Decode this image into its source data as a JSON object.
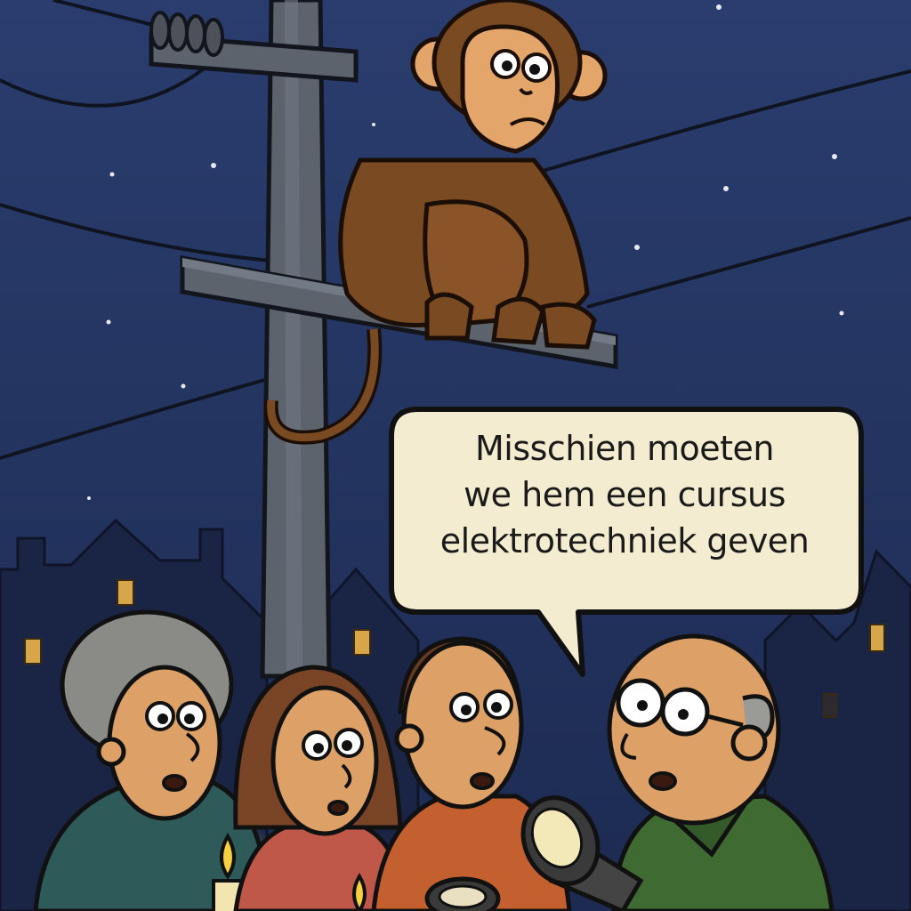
{
  "caption": {
    "lines": [
      "Misschien moeten",
      "we hem een cursus",
      "elektrotechniek geven"
    ]
  },
  "colors": {
    "sky": "#22335e",
    "sky_top": "#283c6c",
    "pole": "#5f6670",
    "monkey": "#7a4a22",
    "monkey_face": "#e3a56a",
    "bubble": "#f3ecd0",
    "houses": "#1b2545",
    "window_light": "#e0b04a"
  }
}
